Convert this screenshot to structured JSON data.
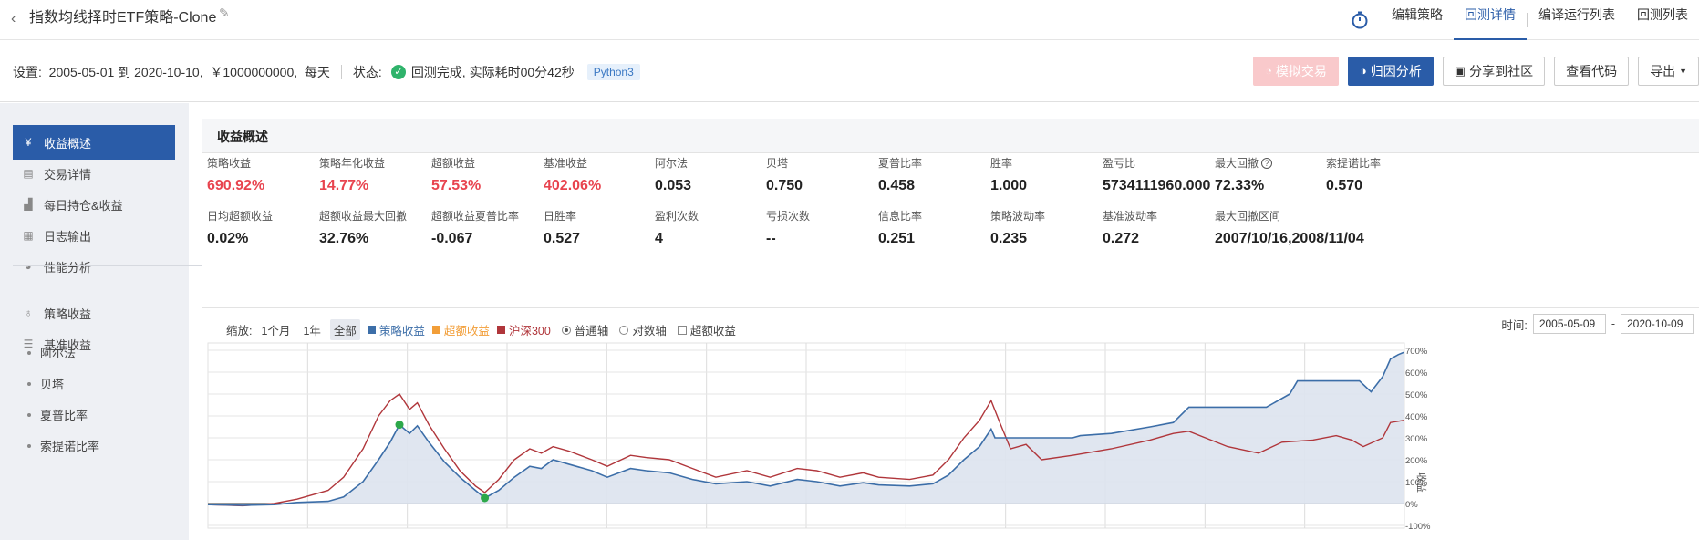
{
  "header": {
    "back_icon": "chevron-left-icon",
    "title": "指数均线择时ETF策略-Clone",
    "edit_icon": "pencil-icon",
    "stopwatch_icon": "stopwatch-icon",
    "nav": [
      "编辑策略",
      "回测详情",
      "编译运行列表",
      "回测列表"
    ],
    "active_nav": "回测详情"
  },
  "settings": {
    "label": "设置:",
    "start": "2005-05-01",
    "to": "到",
    "end": "2020-10-10,",
    "capital": "￥1000000000,",
    "freq": "每天",
    "status_label": "状态:",
    "status": "回测完成,",
    "elapsed": "实际耗时00分42秒",
    "lang": "Python3",
    "status_color": "#2fb36b"
  },
  "buttons": {
    "sim_trade": "模拟交易",
    "attribution": "归因分析",
    "share": "分享到社区",
    "view_code": "查看代码",
    "export": "导出"
  },
  "sidebar": {
    "items": [
      {
        "label": "收益概述",
        "icon": "yen-circle-icon",
        "active": true
      },
      {
        "label": "交易详情",
        "icon": "document-icon"
      },
      {
        "label": "每日持仓&收益",
        "icon": "bar-chart-icon"
      },
      {
        "label": "日志输出",
        "icon": "log-icon"
      },
      {
        "label": "性能分析",
        "icon": "pie-icon"
      },
      {
        "label": "策略收益",
        "icon": "bulb-icon"
      },
      {
        "label": "基准收益",
        "icon": "database-icon"
      }
    ],
    "subitems": [
      "阿尔法",
      "贝塔",
      "夏普比率",
      "索提诺比率"
    ]
  },
  "overview": {
    "title": "收益概述",
    "row1": [
      {
        "label": "策略收益",
        "value": "690.92%",
        "red": true
      },
      {
        "label": "策略年化收益",
        "value": "14.77%",
        "red": true
      },
      {
        "label": "超额收益",
        "value": "57.53%",
        "red": true
      },
      {
        "label": "基准收益",
        "value": "402.06%",
        "red": true
      },
      {
        "label": "阿尔法",
        "value": "0.053"
      },
      {
        "label": "贝塔",
        "value": "0.750"
      },
      {
        "label": "夏普比率",
        "value": "0.458"
      },
      {
        "label": "胜率",
        "value": "1.000"
      },
      {
        "label": "盈亏比",
        "value": "5734111960.000"
      },
      {
        "label": "最大回撤",
        "value": "72.33%",
        "help": "?"
      },
      {
        "label": "索提诺比率",
        "value": "0.570"
      }
    ],
    "row2": [
      {
        "label": "日均超额收益",
        "value": "0.02%"
      },
      {
        "label": "超额收益最大回撤",
        "value": "32.76%"
      },
      {
        "label": "超额收益夏普比率",
        "value": "-0.067"
      },
      {
        "label": "日胜率",
        "value": "0.527"
      },
      {
        "label": "盈利次数",
        "value": "4"
      },
      {
        "label": "亏损次数",
        "value": "--"
      },
      {
        "label": "信息比率",
        "value": "0.251"
      },
      {
        "label": "策略波动率",
        "value": "0.235"
      },
      {
        "label": "基准波动率",
        "value": "0.272"
      },
      {
        "label": "最大回撤区间",
        "value": "2007/10/16,2008/11/04"
      }
    ]
  },
  "chart_controls": {
    "zoom_label": "缩放:",
    "zoom": [
      "1个月",
      "1年",
      "全部"
    ],
    "zoom_active": "全部",
    "legend": [
      {
        "name": "策略收益",
        "color": "#3c6ea8"
      },
      {
        "name": "超额收益",
        "color": "#f29e38"
      },
      {
        "name": "沪深300",
        "color": "#b0363b"
      }
    ],
    "axis_modes": [
      "普通轴",
      "对数轴"
    ],
    "axis_active": "普通轴",
    "excess_checkbox": "超额收益",
    "time_label": "时间:",
    "date_from": "2005-05-09",
    "date_dash": "-",
    "date_to": "2020-10-09"
  },
  "chart_data": {
    "type": "line",
    "ylabel": "收益",
    "ylim": [
      -100,
      700
    ],
    "yticks": [
      "700%",
      "600%",
      "500%",
      "400%",
      "300%",
      "200%",
      "100%",
      "0%",
      "-100%"
    ],
    "ytick_values": [
      700,
      600,
      500,
      400,
      300,
      200,
      100,
      0,
      -100
    ],
    "grid": true,
    "x_range": [
      "2005-05-09",
      "2020-10-09"
    ],
    "series": [
      {
        "name": "策略收益",
        "color": "#3c6ea8",
        "fill": "#dde3ee",
        "points": [
          [
            2005.35,
            -5
          ],
          [
            2005.8,
            -8
          ],
          [
            2006.2,
            -5
          ],
          [
            2006.5,
            5
          ],
          [
            2006.9,
            10
          ],
          [
            2007.1,
            30
          ],
          [
            2007.35,
            100
          ],
          [
            2007.55,
            200
          ],
          [
            2007.7,
            280
          ],
          [
            2007.82,
            360
          ],
          [
            2007.95,
            320
          ],
          [
            2008.05,
            355
          ],
          [
            2008.2,
            280
          ],
          [
            2008.4,
            190
          ],
          [
            2008.6,
            120
          ],
          [
            2008.8,
            60
          ],
          [
            2008.92,
            25
          ],
          [
            2009.1,
            60
          ],
          [
            2009.3,
            120
          ],
          [
            2009.5,
            170
          ],
          [
            2009.65,
            160
          ],
          [
            2009.8,
            200
          ],
          [
            2010.0,
            180
          ],
          [
            2010.3,
            150
          ],
          [
            2010.5,
            120
          ],
          [
            2010.8,
            160
          ],
          [
            2011.0,
            150
          ],
          [
            2011.3,
            140
          ],
          [
            2011.6,
            110
          ],
          [
            2011.9,
            90
          ],
          [
            2012.3,
            100
          ],
          [
            2012.6,
            80
          ],
          [
            2012.95,
            110
          ],
          [
            2013.2,
            100
          ],
          [
            2013.5,
            80
          ],
          [
            2013.8,
            95
          ],
          [
            2014.0,
            85
          ],
          [
            2014.4,
            80
          ],
          [
            2014.7,
            90
          ],
          [
            2014.9,
            130
          ],
          [
            2015.1,
            200
          ],
          [
            2015.3,
            260
          ],
          [
            2015.45,
            340
          ],
          [
            2015.5,
            300
          ],
          [
            2015.6,
            300
          ],
          [
            2016.5,
            300
          ],
          [
            2016.6,
            310
          ],
          [
            2017.0,
            320
          ],
          [
            2017.5,
            350
          ],
          [
            2017.8,
            370
          ],
          [
            2018.0,
            440
          ],
          [
            2018.5,
            440
          ],
          [
            2019.0,
            440
          ],
          [
            2019.3,
            500
          ],
          [
            2019.4,
            560
          ],
          [
            2019.6,
            560
          ],
          [
            2020.2,
            560
          ],
          [
            2020.35,
            510
          ],
          [
            2020.5,
            580
          ],
          [
            2020.6,
            660
          ],
          [
            2020.7,
            680
          ],
          [
            2020.77,
            690
          ]
        ]
      },
      {
        "name": "沪深300",
        "color": "#b0363b",
        "fill": "none",
        "points": [
          [
            2005.35,
            -5
          ],
          [
            2005.8,
            -10
          ],
          [
            2006.2,
            0
          ],
          [
            2006.5,
            20
          ],
          [
            2006.9,
            60
          ],
          [
            2007.1,
            120
          ],
          [
            2007.35,
            250
          ],
          [
            2007.55,
            400
          ],
          [
            2007.7,
            470
          ],
          [
            2007.82,
            500
          ],
          [
            2007.95,
            430
          ],
          [
            2008.05,
            460
          ],
          [
            2008.2,
            360
          ],
          [
            2008.4,
            250
          ],
          [
            2008.6,
            150
          ],
          [
            2008.8,
            80
          ],
          [
            2008.92,
            50
          ],
          [
            2009.1,
            110
          ],
          [
            2009.3,
            200
          ],
          [
            2009.5,
            250
          ],
          [
            2009.65,
            230
          ],
          [
            2009.8,
            260
          ],
          [
            2010.0,
            240
          ],
          [
            2010.3,
            200
          ],
          [
            2010.5,
            170
          ],
          [
            2010.8,
            220
          ],
          [
            2011.0,
            210
          ],
          [
            2011.3,
            200
          ],
          [
            2011.6,
            160
          ],
          [
            2011.9,
            120
          ],
          [
            2012.3,
            150
          ],
          [
            2012.6,
            120
          ],
          [
            2012.95,
            160
          ],
          [
            2013.2,
            150
          ],
          [
            2013.5,
            120
          ],
          [
            2013.8,
            140
          ],
          [
            2014.0,
            120
          ],
          [
            2014.4,
            110
          ],
          [
            2014.7,
            130
          ],
          [
            2014.9,
            200
          ],
          [
            2015.1,
            300
          ],
          [
            2015.3,
            380
          ],
          [
            2015.45,
            470
          ],
          [
            2015.55,
            380
          ],
          [
            2015.7,
            250
          ],
          [
            2015.9,
            270
          ],
          [
            2016.1,
            200
          ],
          [
            2016.5,
            220
          ],
          [
            2017.0,
            250
          ],
          [
            2017.5,
            290
          ],
          [
            2017.8,
            320
          ],
          [
            2018.0,
            330
          ],
          [
            2018.5,
            260
          ],
          [
            2018.9,
            230
          ],
          [
            2019.2,
            280
          ],
          [
            2019.6,
            290
          ],
          [
            2019.9,
            310
          ],
          [
            2020.1,
            290
          ],
          [
            2020.25,
            260
          ],
          [
            2020.5,
            300
          ],
          [
            2020.6,
            370
          ],
          [
            2020.77,
            380
          ]
        ]
      }
    ],
    "markers": [
      {
        "series": "策略收益",
        "x": 2007.82,
        "y": 360,
        "color": "#2da84a"
      },
      {
        "series": "策略收益",
        "x": 2008.92,
        "y": 25,
        "color": "#2da84a"
      }
    ]
  }
}
